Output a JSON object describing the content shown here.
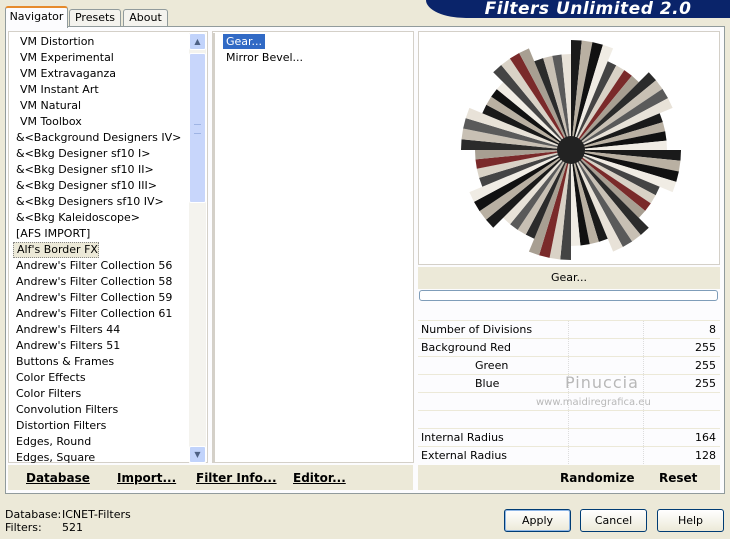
{
  "app": {
    "title": "Filters Unlimited 2.0"
  },
  "tabs": [
    "Navigator",
    "Presets",
    "About"
  ],
  "filter_categories": [
    "VM Distortion",
    "VM Experimental",
    "VM Extravaganza",
    "VM Instant Art",
    "VM Natural",
    "VM Toolbox",
    "&<Background Designers IV>",
    "&<Bkg Designer sf10 I>",
    "&<Bkg Designer sf10 II>",
    "&<Bkg Designer sf10 III>",
    "&<Bkg Designers sf10 IV>",
    "&<Bkg Kaleidoscope>",
    "[AFS IMPORT]",
    "Alf's Border FX",
    "Andrew's Filter Collection 56",
    "Andrew's Filter Collection 58",
    "Andrew's Filter Collection 59",
    "Andrew's Filter Collection 61",
    "Andrew's Filters 44",
    "Andrew's Filters 51",
    "Buttons & Frames",
    "Color Effects",
    "Color Filters",
    "Convolution Filters",
    "Distortion Filters",
    "Edges, Round",
    "Edges, Square"
  ],
  "selected_category": "Alf's Border FX",
  "filters": [
    "Gear...",
    "Mirror Bevel..."
  ],
  "selected_filter": "Gear...",
  "preview": {
    "filter_name": "Gear...",
    "progress": 0
  },
  "params": [
    {
      "label": "Number of Divisions",
      "value": "8",
      "indent": false
    },
    {
      "label": "Background Red",
      "value": "255",
      "indent": false
    },
    {
      "label": "Green",
      "value": "255",
      "indent": true
    },
    {
      "label": "Blue",
      "value": "255",
      "indent": true
    },
    {
      "label": "",
      "value": "",
      "indent": false
    },
    {
      "label": "",
      "value": "",
      "indent": false
    },
    {
      "label": "Internal Radius",
      "value": "164",
      "indent": false
    },
    {
      "label": "External Radius",
      "value": "128",
      "indent": false
    }
  ],
  "watermark": {
    "name": "Pinuccia",
    "url": "www.maidiregrafica.eu"
  },
  "buttons": {
    "database": "Database",
    "import": "Import...",
    "filter_info": "Filter Info...",
    "editor": "Editor...",
    "randomize": "Randomize",
    "reset": "Reset",
    "apply": "Apply",
    "cancel": "Cancel",
    "help": "Help"
  },
  "status": {
    "database_label": "Database:",
    "database_value": "ICNET-Filters",
    "filters_label": "Filters:",
    "filters_value": "521"
  },
  "colors": {
    "banner": "#0a246a",
    "selection": "#316ac5",
    "background": "#ece9d8"
  }
}
